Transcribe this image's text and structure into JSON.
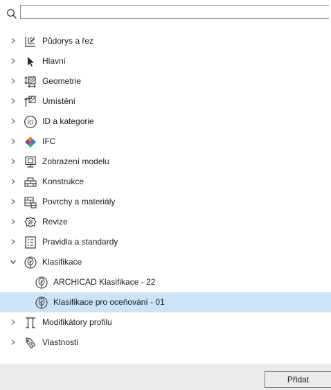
{
  "search": {
    "value": "",
    "placeholder": ""
  },
  "tree": {
    "items": [
      {
        "label": "Půdorys a řez",
        "icon": "floorplan-section-icon",
        "expanded": false
      },
      {
        "label": "Hlavní",
        "icon": "cursor-arrow-icon",
        "expanded": false
      },
      {
        "label": "Geometrie",
        "icon": "geometry-icon",
        "expanded": false
      },
      {
        "label": "Umístění",
        "icon": "placement-icon",
        "expanded": false
      },
      {
        "label": "ID a kategorie",
        "icon": "id-icon",
        "expanded": false
      },
      {
        "label": "IFC",
        "icon": "ifc-icon",
        "expanded": false
      },
      {
        "label": "Zobrazení modelu",
        "icon": "model-view-icon",
        "expanded": false
      },
      {
        "label": "Konstrukce",
        "icon": "structure-icon",
        "expanded": false
      },
      {
        "label": "Povrchy a materiály",
        "icon": "surfaces-icon",
        "expanded": false
      },
      {
        "label": "Revize",
        "icon": "revision-icon",
        "expanded": false
      },
      {
        "label": "Pravidla a standardy",
        "icon": "rules-icon",
        "expanded": false
      },
      {
        "label": "Klasifikace",
        "icon": "classification-icon",
        "expanded": true
      },
      {
        "label": "ARCHICAD Klasifikace - 22",
        "icon": "classification-icon",
        "child": true
      },
      {
        "label": "Klasifikace pro oceňování - 01",
        "icon": "classification-icon",
        "child": true,
        "selected": true
      },
      {
        "label": "Modifikátory profilu",
        "icon": "profile-modifier-icon",
        "expanded": false
      },
      {
        "label": "Vlastnosti",
        "icon": "properties-icon",
        "expanded": false
      }
    ]
  },
  "footer": {
    "add_label": "Přidat"
  },
  "colors": {
    "selection": "#cce4f7",
    "footer_bg": "#ececec",
    "ifc_orange": "#e8752b",
    "ifc_purple": "#8a3c9c",
    "ifc_blue": "#2f7fc1",
    "ifc_teal": "#37a28e"
  }
}
